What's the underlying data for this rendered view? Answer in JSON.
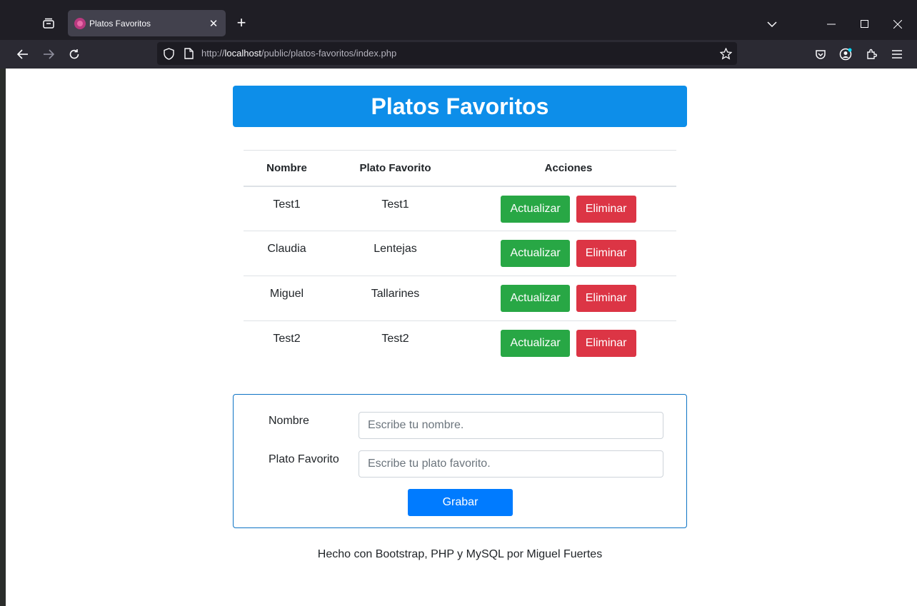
{
  "browser": {
    "tab_title": "Platos Favoritos",
    "url": {
      "scheme": "http://",
      "host": "localhost",
      "path": "/public/platos-favoritos/index.php"
    }
  },
  "page": {
    "title": "Platos Favoritos",
    "header_color": "#0d8ee9"
  },
  "table": {
    "headers": {
      "nombre": "Nombre",
      "plato": "Plato Favorito",
      "acciones": "Acciones"
    },
    "rows": [
      {
        "nombre": "Test1",
        "plato": "Test1",
        "update_label": "Actualizar",
        "delete_label": "Eliminar"
      },
      {
        "nombre": "Claudia",
        "plato": "Lentejas",
        "update_label": "Actualizar",
        "delete_label": "Eliminar"
      },
      {
        "nombre": "Miguel",
        "plato": "Tallarines",
        "update_label": "Actualizar",
        "delete_label": "Eliminar"
      },
      {
        "nombre": "Test2",
        "plato": "Test2",
        "update_label": "Actualizar",
        "delete_label": "Eliminar"
      }
    ]
  },
  "form": {
    "nombre_label": "Nombre",
    "nombre_placeholder": "Escribe tu nombre.",
    "plato_label": "Plato Favorito",
    "plato_placeholder": "Escribe tu plato favorito.",
    "submit_label": "Grabar"
  },
  "footer": {
    "text": "Hecho con Bootstrap, PHP y MySQL por Miguel Fuertes"
  },
  "colors": {
    "success": "#28a745",
    "danger": "#dc3545",
    "primary": "#007bff"
  }
}
